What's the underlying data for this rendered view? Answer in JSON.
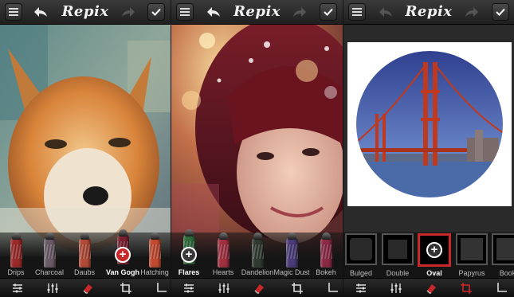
{
  "app": {
    "title": "Repix"
  },
  "panels": [
    {
      "id": "left",
      "tools": [
        {
          "label": "Drips",
          "color": "#9a2a2a",
          "selected": false
        },
        {
          "label": "Charcoal",
          "color": "#6a5a66",
          "selected": false
        },
        {
          "label": "Daubs",
          "color": "#b04a36",
          "selected": false
        },
        {
          "label": "Van Gogh",
          "color": "#7a2030",
          "selected": true
        },
        {
          "label": "Hatching",
          "color": "#c04a30",
          "selected": false
        }
      ]
    },
    {
      "id": "middle",
      "tools": [
        {
          "label": "Flares",
          "color": "#2f6a3a",
          "selected": true
        },
        {
          "label": "Hearts",
          "color": "#a03040",
          "selected": false
        },
        {
          "label": "Dandelion",
          "color": "#303a30",
          "selected": false
        },
        {
          "label": "Magic Dust",
          "color": "#4a3a78",
          "selected": false
        },
        {
          "label": "Bokeh",
          "color": "#8a2a44",
          "selected": false
        }
      ]
    },
    {
      "id": "right",
      "frames": [
        {
          "label": "Bulged",
          "selected": false
        },
        {
          "label": "Double",
          "selected": false
        },
        {
          "label": "Oval",
          "selected": true
        },
        {
          "label": "Papyrus",
          "selected": false
        },
        {
          "label": "Book",
          "selected": false
        }
      ]
    }
  ],
  "colors": {
    "accent": "#c8282a",
    "bar": "#1f1f1f"
  },
  "icons": [
    "menu-icon",
    "back-arrow-icon",
    "forward-arrow-icon",
    "checkmark-icon",
    "adjust-sliders-icon",
    "eraser-icon",
    "crop-icon",
    "plus-icon"
  ]
}
